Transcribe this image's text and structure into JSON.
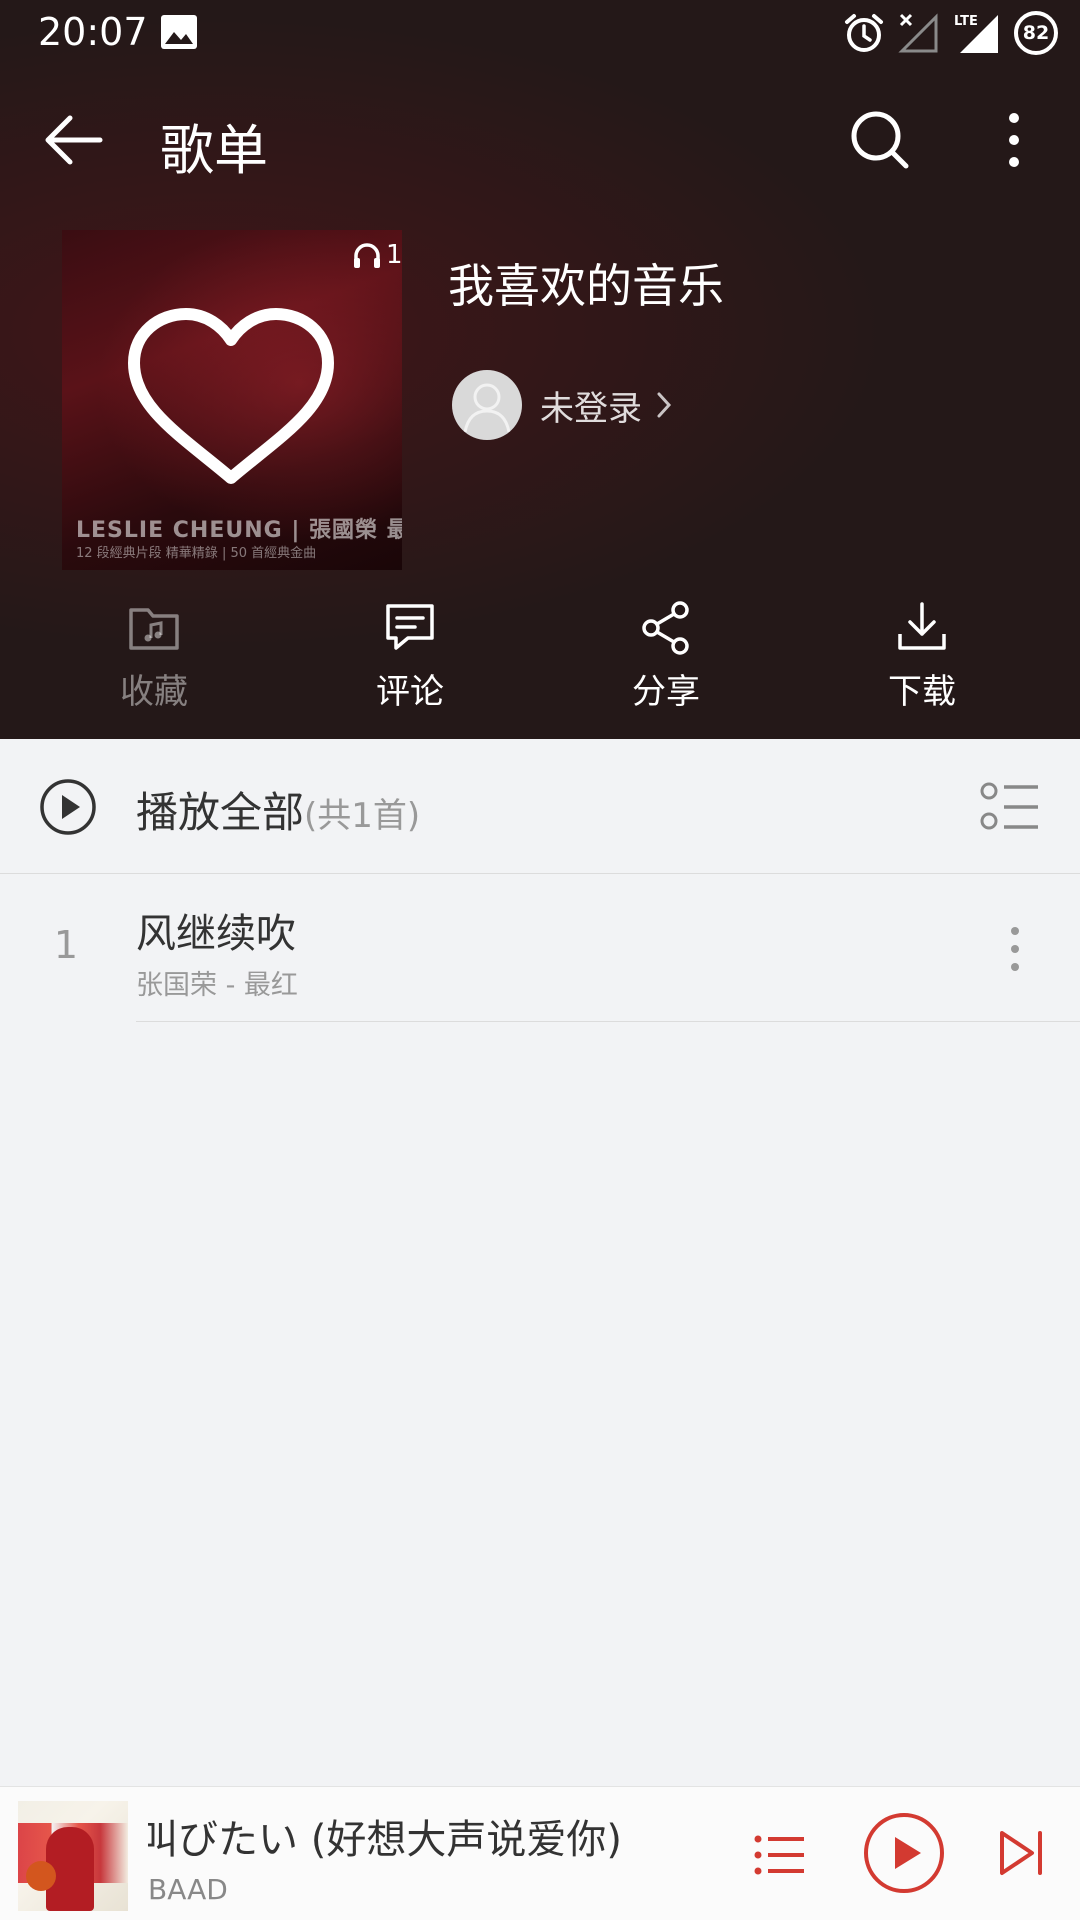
{
  "status_bar": {
    "time": "20:07",
    "network": "LTE",
    "battery": "82",
    "icons": [
      "gallery-icon",
      "alarm-icon",
      "no-signal-icon",
      "lte-signal-icon",
      "battery-icon"
    ]
  },
  "topbar": {
    "title": "歌单",
    "icons": [
      "back-arrow-icon",
      "search-icon",
      "more-vertical-icon"
    ]
  },
  "playlist": {
    "name": "我喜欢的音乐",
    "play_count": "1",
    "cover_text_line1": "LESLIE CHEUNG | 張國榮 最紅",
    "cover_text_line2": "12 段經典片段 精華精錄 | 50 首經典金曲",
    "creator_name": "未登录"
  },
  "actions": [
    {
      "label": "收藏",
      "icon": "folder-music-icon",
      "enabled": false
    },
    {
      "label": "评论",
      "icon": "comment-icon",
      "enabled": true
    },
    {
      "label": "分享",
      "icon": "share-icon",
      "enabled": true
    },
    {
      "label": "下载",
      "icon": "download-icon",
      "enabled": true
    }
  ],
  "play_all": {
    "label": "播放全部",
    "count": "(共1首)"
  },
  "songs": [
    {
      "index": "1",
      "title": "风继续吹",
      "subtitle": "张国荣 - 最红"
    }
  ],
  "mini_player": {
    "title": "叫びたい (好想大声说爱你)",
    "artist": "BAAD"
  },
  "colors": {
    "header_bg": "#241818",
    "accent": "#d33a31",
    "page_bg": "#f2f3f5"
  }
}
